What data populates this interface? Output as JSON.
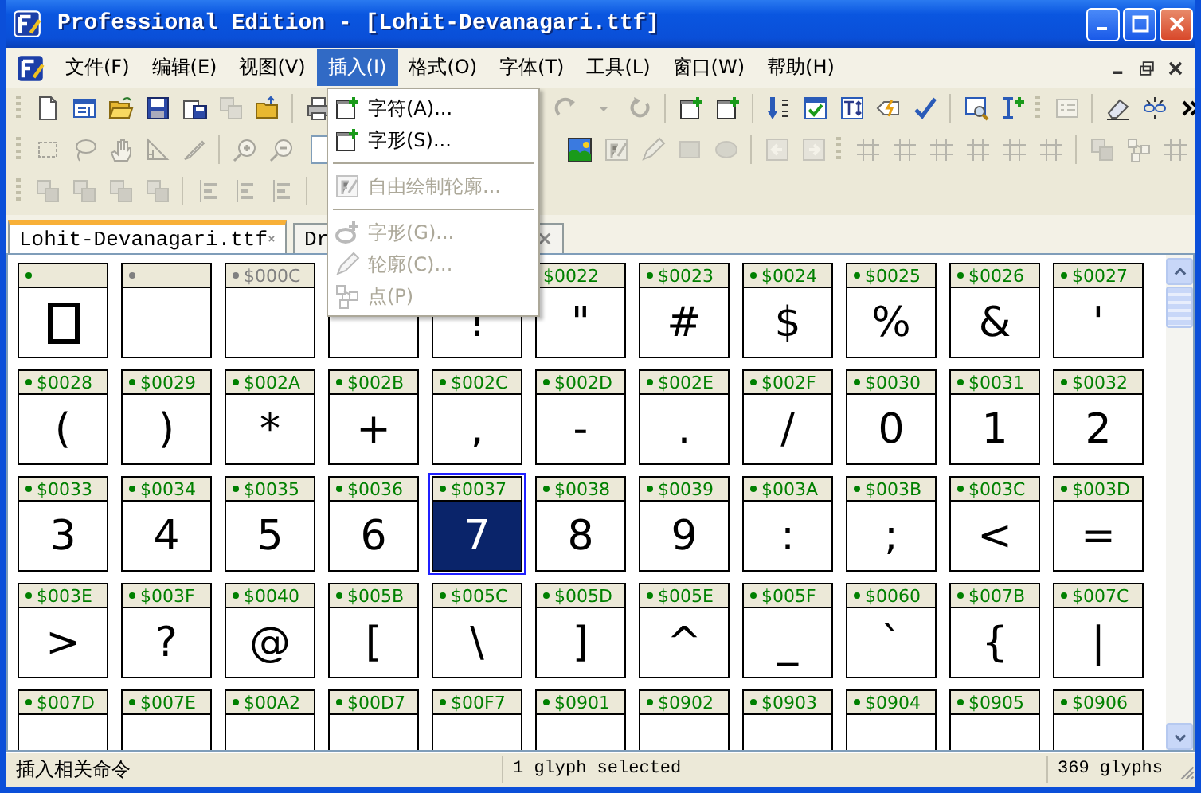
{
  "window": {
    "title": "Professional Edition - [Lohit-Devanagari.ttf]"
  },
  "menu_bar": [
    {
      "label": "文件(F)",
      "selected": false
    },
    {
      "label": "编辑(E)",
      "selected": false
    },
    {
      "label": "视图(V)",
      "selected": false
    },
    {
      "label": "插入(I)",
      "selected": true
    },
    {
      "label": "格式(O)",
      "selected": false
    },
    {
      "label": "字体(T)",
      "selected": false
    },
    {
      "label": "工具(L)",
      "selected": false
    },
    {
      "label": "窗口(W)",
      "selected": false
    },
    {
      "label": "帮助(H)",
      "selected": false
    }
  ],
  "toolbars": [
    {
      "left": [
        {
          "kind": "grip"
        },
        {
          "kind": "new",
          "disabled": false
        },
        {
          "kind": "properties",
          "disabled": false
        },
        {
          "kind": "open",
          "disabled": false
        },
        {
          "kind": "save",
          "disabled": false
        },
        {
          "kind": "save-as",
          "disabled": false
        },
        {
          "kind": "copy",
          "disabled": true
        },
        {
          "kind": "folder",
          "disabled": false
        },
        {
          "kind": "separator"
        },
        {
          "kind": "print",
          "disabled": false
        }
      ],
      "right": [
        {
          "kind": "redo",
          "disabled": true
        },
        {
          "kind": "caret",
          "disabled": true
        },
        {
          "kind": "refresh",
          "disabled": true
        },
        {
          "kind": "separator"
        },
        {
          "kind": "add-window",
          "disabled": false
        },
        {
          "kind": "add-window",
          "disabled": false
        },
        {
          "kind": "separator"
        },
        {
          "kind": "sort",
          "disabled": false
        },
        {
          "kind": "check-window",
          "disabled": false
        },
        {
          "kind": "text-height",
          "disabled": false
        },
        {
          "kind": "tag",
          "disabled": false
        },
        {
          "kind": "checkmark",
          "disabled": false
        },
        {
          "kind": "separator"
        },
        {
          "kind": "search",
          "disabled": false
        },
        {
          "kind": "insert",
          "disabled": false
        },
        {
          "kind": "grip"
        },
        {
          "kind": "panel",
          "disabled": true
        },
        {
          "kind": "separator"
        },
        {
          "kind": "eraser",
          "disabled": false
        },
        {
          "kind": "link",
          "disabled": false
        },
        {
          "kind": "chevron",
          "disabled": false
        }
      ]
    },
    {
      "left": [
        {
          "kind": "grip"
        },
        {
          "kind": "select",
          "disabled": true
        },
        {
          "kind": "lasso",
          "disabled": true
        },
        {
          "kind": "hand",
          "disabled": true
        },
        {
          "kind": "ruler",
          "disabled": true
        },
        {
          "kind": "knife",
          "disabled": true
        },
        {
          "kind": "separator"
        },
        {
          "kind": "zoom-in",
          "disabled": true
        },
        {
          "kind": "zoom-out",
          "disabled": true
        },
        {
          "kind": "field"
        }
      ],
      "right": [
        {
          "kind": "picture",
          "disabled": false
        },
        {
          "kind": "f-edit",
          "disabled": true
        },
        {
          "kind": "pencil",
          "disabled": true
        },
        {
          "kind": "rect",
          "disabled": true
        },
        {
          "kind": "ellipse",
          "disabled": true
        },
        {
          "kind": "separator"
        },
        {
          "kind": "left",
          "disabled": true
        },
        {
          "kind": "right",
          "disabled": true
        },
        {
          "kind": "grip"
        },
        {
          "kind": "grid",
          "disabled": true
        },
        {
          "kind": "grid",
          "disabled": true
        },
        {
          "kind": "grid",
          "disabled": true
        },
        {
          "kind": "grid",
          "disabled": true
        },
        {
          "kind": "grid",
          "disabled": true
        },
        {
          "kind": "grid",
          "disabled": true
        },
        {
          "kind": "separator"
        },
        {
          "kind": "layers",
          "disabled": true
        },
        {
          "kind": "nodes",
          "disabled": true
        },
        {
          "kind": "grid",
          "disabled": true
        }
      ]
    },
    {
      "left": [
        {
          "kind": "grip"
        },
        {
          "kind": "layers",
          "disabled": true
        },
        {
          "kind": "layers",
          "disabled": true
        },
        {
          "kind": "layers",
          "disabled": true
        },
        {
          "kind": "layers",
          "disabled": true
        },
        {
          "kind": "separator"
        },
        {
          "kind": "align",
          "disabled": true
        },
        {
          "kind": "align",
          "disabled": true
        },
        {
          "kind": "align",
          "disabled": true
        },
        {
          "kind": "separator"
        }
      ]
    }
  ],
  "tabs": [
    {
      "label": "Lohit-Devanagari.ttf",
      "selected": true
    },
    {
      "label": "Dr",
      "selected": false
    }
  ],
  "insert_menu": [
    {
      "kind": "item",
      "label": "字符(A)...",
      "disabled": false
    },
    {
      "kind": "item",
      "label": "字形(S)...",
      "disabled": false
    },
    {
      "kind": "separator"
    },
    {
      "kind": "item",
      "label": "自由绘制轮廓...",
      "disabled": true
    },
    {
      "kind": "separator"
    },
    {
      "kind": "item",
      "label": "字形(G)...",
      "disabled": true
    },
    {
      "kind": "item",
      "label": "轮廓(C)...",
      "disabled": true
    },
    {
      "kind": "item",
      "label": "点(P)",
      "disabled": true
    }
  ],
  "glyph_grid": {
    "cells": [
      {
        "mapped": true,
        "kind": "notdef",
        "selected": false
      },
      {
        "mapped": false,
        "selected": false
      },
      {
        "code": "$000C",
        "mapped": false,
        "selected": false
      },
      {
        "selected": false
      },
      {
        "glyph": "!",
        "selected": false
      },
      {
        "code": "$0022",
        "glyph": "\"",
        "selected": false
      },
      {
        "code": "$0023",
        "mapped": true,
        "glyph": "#",
        "selected": false
      },
      {
        "code": "$0024",
        "mapped": true,
        "glyph": "$",
        "selected": false
      },
      {
        "code": "$0025",
        "mapped": true,
        "glyph": "%",
        "selected": false
      },
      {
        "code": "$0026",
        "mapped": true,
        "glyph": "&",
        "selected": false
      },
      {
        "code": "$0027",
        "mapped": true,
        "glyph": "'",
        "selected": false
      },
      {
        "code": "$0028",
        "mapped": true,
        "glyph": "(",
        "selected": false
      },
      {
        "code": "$0029",
        "mapped": true,
        "glyph": ")",
        "selected": false
      },
      {
        "code": "$002A",
        "mapped": true,
        "glyph": "*",
        "selected": false
      },
      {
        "code": "$002B",
        "mapped": true,
        "glyph": "+",
        "selected": false
      },
      {
        "code": "$002C",
        "mapped": true,
        "glyph": ",",
        "selected": false
      },
      {
        "code": "$002D",
        "mapped": true,
        "glyph": "-",
        "selected": false
      },
      {
        "code": "$002E",
        "mapped": true,
        "glyph": ".",
        "selected": false
      },
      {
        "code": "$002F",
        "mapped": true,
        "glyph": "/",
        "selected": false
      },
      {
        "code": "$0030",
        "mapped": true,
        "glyph": "0",
        "selected": false
      },
      {
        "code": "$0031",
        "mapped": true,
        "glyph": "1",
        "selected": false
      },
      {
        "code": "$0032",
        "mapped": true,
        "glyph": "2",
        "selected": false
      },
      {
        "code": "$0033",
        "mapped": true,
        "glyph": "3",
        "selected": false
      },
      {
        "code": "$0034",
        "mapped": true,
        "glyph": "4",
        "selected": false
      },
      {
        "code": "$0035",
        "mapped": true,
        "glyph": "5",
        "selected": false
      },
      {
        "code": "$0036",
        "mapped": true,
        "glyph": "6",
        "selected": false
      },
      {
        "code": "$0037",
        "mapped": true,
        "glyph": "7",
        "selected": true
      },
      {
        "code": "$0038",
        "mapped": true,
        "glyph": "8",
        "selected": false
      },
      {
        "code": "$0039",
        "mapped": true,
        "glyph": "9",
        "selected": false
      },
      {
        "code": "$003A",
        "mapped": true,
        "glyph": ":",
        "selected": false
      },
      {
        "code": "$003B",
        "mapped": true,
        "glyph": ";",
        "selected": false
      },
      {
        "code": "$003C",
        "mapped": true,
        "glyph": "<",
        "selected": false
      },
      {
        "code": "$003D",
        "mapped": true,
        "glyph": "=",
        "selected": false
      },
      {
        "code": "$003E",
        "mapped": true,
        "glyph": ">",
        "selected": false
      },
      {
        "code": "$003F",
        "mapped": true,
        "glyph": "?",
        "selected": false
      },
      {
        "code": "$0040",
        "mapped": true,
        "glyph": "@",
        "selected": false
      },
      {
        "code": "$005B",
        "mapped": true,
        "glyph": "[",
        "selected": false
      },
      {
        "code": "$005C",
        "mapped": true,
        "glyph": "\\",
        "selected": false
      },
      {
        "code": "$005D",
        "mapped": true,
        "glyph": "]",
        "selected": false
      },
      {
        "code": "$005E",
        "mapped": true,
        "glyph": "^",
        "selected": false
      },
      {
        "code": "$005F",
        "mapped": true,
        "glyph": "_",
        "selected": false
      },
      {
        "code": "$0060",
        "mapped": true,
        "glyph": "`",
        "selected": false
      },
      {
        "code": "$007B",
        "mapped": true,
        "glyph": "{",
        "selected": false
      },
      {
        "code": "$007C",
        "mapped": true,
        "glyph": "|",
        "selected": false
      },
      {
        "code": "$007D",
        "mapped": true,
        "selected": false
      },
      {
        "code": "$007E",
        "mapped": true,
        "selected": false
      },
      {
        "code": "$00A2",
        "mapped": true,
        "selected": false
      },
      {
        "code": "$00D7",
        "mapped": true,
        "selected": false
      },
      {
        "code": "$00F7",
        "mapped": true,
        "selected": false
      },
      {
        "code": "$0901",
        "mapped": true,
        "selected": false
      },
      {
        "code": "$0902",
        "mapped": true,
        "selected": false
      },
      {
        "code": "$0903",
        "mapped": true,
        "selected": false
      },
      {
        "code": "$0904",
        "mapped": true,
        "selected": false
      },
      {
        "code": "$0905",
        "mapped": true,
        "selected": false
      },
      {
        "code": "$0906",
        "mapped": true,
        "selected": false
      }
    ]
  },
  "status_bar": {
    "message": "插入相关命令",
    "selection": "1 glyph selected",
    "count": "369 glyphs"
  }
}
